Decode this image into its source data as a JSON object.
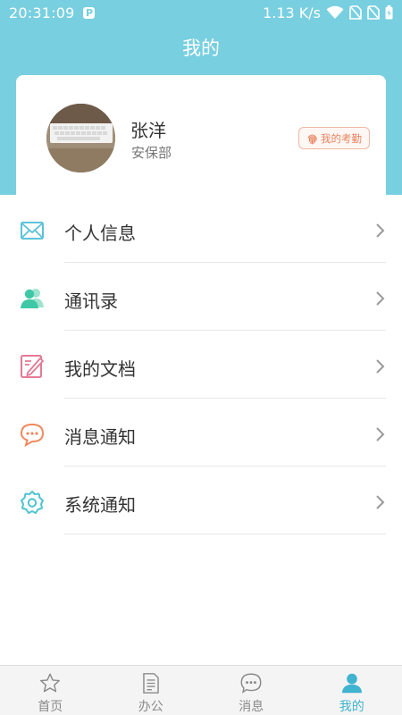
{
  "status_bar": {
    "time": "20:31:09",
    "app_indicator": "P",
    "network_speed": "1.13 K/s",
    "icons": [
      "wifi-icon",
      "no-sim-icon",
      "no-sim-icon",
      "battery-icon"
    ]
  },
  "header": {
    "title": "我的"
  },
  "profile": {
    "name": "张洋",
    "department": "安保部",
    "attendance_label": "我的考勤",
    "avatar_icon": "keyboard-photo"
  },
  "menu": [
    {
      "label": "个人信息",
      "icon": "mail-icon",
      "color": "#5bc3d8"
    },
    {
      "label": "通讯录",
      "icon": "contacts-icon",
      "color": "#3ec8a6"
    },
    {
      "label": "我的文档",
      "icon": "document-edit-icon",
      "color": "#e57a96"
    },
    {
      "label": "消息通知",
      "icon": "chat-bubble-icon",
      "color": "#ee8a60"
    },
    {
      "label": "系统通知",
      "icon": "gear-icon",
      "color": "#4fc3cf"
    }
  ],
  "tabs": [
    {
      "label": "首页",
      "icon": "star-icon",
      "active": false
    },
    {
      "label": "办公",
      "icon": "document-icon",
      "active": false
    },
    {
      "label": "消息",
      "icon": "message-icon",
      "active": false
    },
    {
      "label": "我的",
      "icon": "person-icon",
      "active": true
    }
  ],
  "colors": {
    "header_bg": "#78cfe0",
    "accent": "#3fb3cf",
    "attendance": "#e8835f"
  }
}
